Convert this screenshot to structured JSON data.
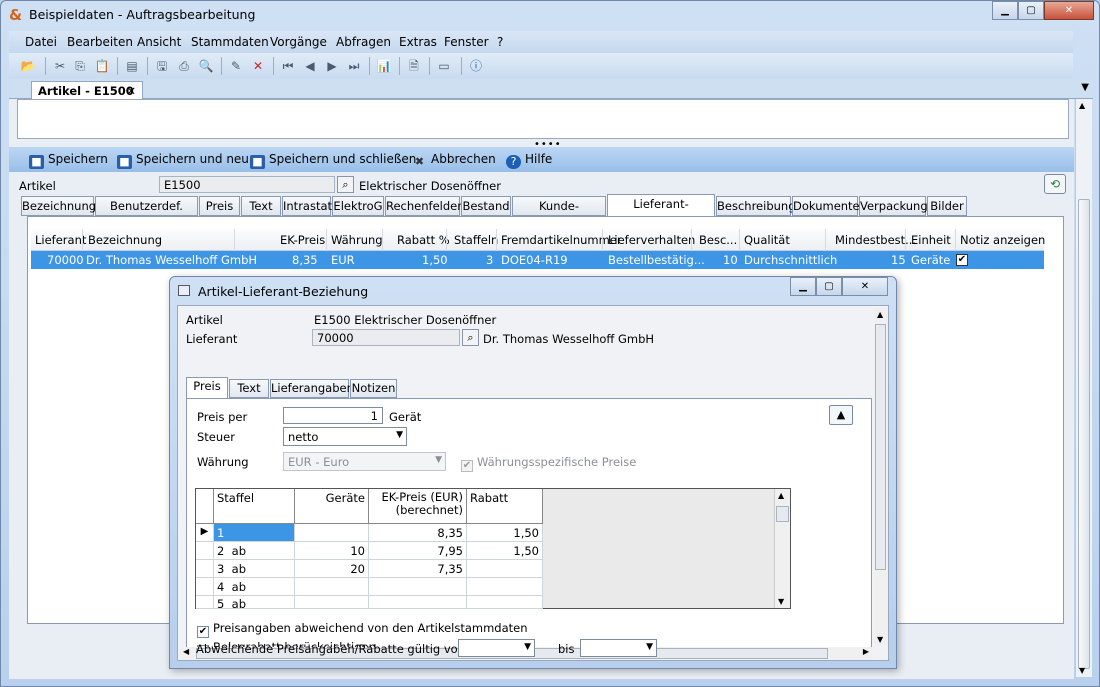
{
  "window": {
    "title": "Beispieldaten - Auftragsbearbeitung"
  },
  "menu": [
    "Datei",
    "Bearbeiten",
    "Ansicht",
    "Stammdaten",
    "Vorgänge",
    "Abfragen",
    "Extras",
    "Fenster",
    "?"
  ],
  "doc_tab": "Artikel - E1500",
  "actions": {
    "save": "Speichern",
    "save_new": "Speichern und neu",
    "save_close": "Speichern und schließen",
    "cancel": "Abbrechen",
    "help": "Hilfe"
  },
  "article": {
    "label": "Artikel",
    "number": "E1500",
    "name": "Elektrischer Dosenöffner"
  },
  "tabs": [
    "Bezeichnung",
    "Benutzerdef. Felder",
    "Preis",
    "Text",
    "Intrastat",
    "ElektroG",
    "Rechenfelder",
    "Bestand",
    "Kunde-Beziehung",
    "Lieferant-Beziehung",
    "Beschreibung",
    "Dokumente",
    "Verpackung",
    "Bilder"
  ],
  "grid": {
    "headers": [
      "Lieferant",
      "Bezeichnung",
      "EK-Preis",
      "Währung",
      "Rabatt %",
      "Staffeln",
      "Fremdartikelnummer",
      "Lieferverhalten",
      "Besc...",
      "Qualität",
      "Mindestbest...",
      "Einheit",
      "Notiz anzeigen"
    ],
    "row": [
      "70000",
      "Dr. Thomas Wesselhoff GmbH",
      "8,35",
      "EUR",
      "1,50",
      "3",
      "DOE04-R19",
      "Bestellbestätig...",
      "10",
      "Durchschnittlich",
      "15",
      "Geräte"
    ]
  },
  "dialog": {
    "title": "Artikel-Lieferant-Beziehung",
    "artikel_label": "Artikel",
    "artikel_value": "E1500 Elektrischer Dosenöffner",
    "lieferant_label": "Lieferant",
    "lieferant_number": "70000",
    "lieferant_name": "Dr. Thomas Wesselhoff GmbH",
    "tabs": [
      "Preis",
      "Text",
      "Lieferangaben",
      "Notizen"
    ],
    "preis_per_label": "Preis per",
    "preis_per_value": "1",
    "preis_per_unit": "Gerät",
    "steuer_label": "Steuer",
    "steuer_value": "netto",
    "waehrung_label": "Währung",
    "waehrung_value": "EUR - Euro",
    "waehrung_check": "Währungsspezifische Preise",
    "staffel_headers": [
      "Staffel",
      "Geräte",
      "EK-Preis (EUR)",
      "(berechnet)",
      "Rabatt"
    ],
    "staffel_rows": [
      [
        "1",
        "",
        "",
        "8,35",
        "1,50"
      ],
      [
        "2",
        "ab",
        "10",
        "7,95",
        "1,50"
      ],
      [
        "3",
        "ab",
        "20",
        "7,35",
        ""
      ],
      [
        "4",
        "ab",
        "",
        "",
        ""
      ],
      [
        "5",
        "ab",
        "",
        "",
        ""
      ]
    ],
    "check1": "Preisangaben abweichend von den Artikelstammdaten",
    "check2": "Belegrabatt berücksichtigen",
    "valid_label": "Abweichende Preisangaben/Rabatte gültig von",
    "bis_label": "bis"
  }
}
